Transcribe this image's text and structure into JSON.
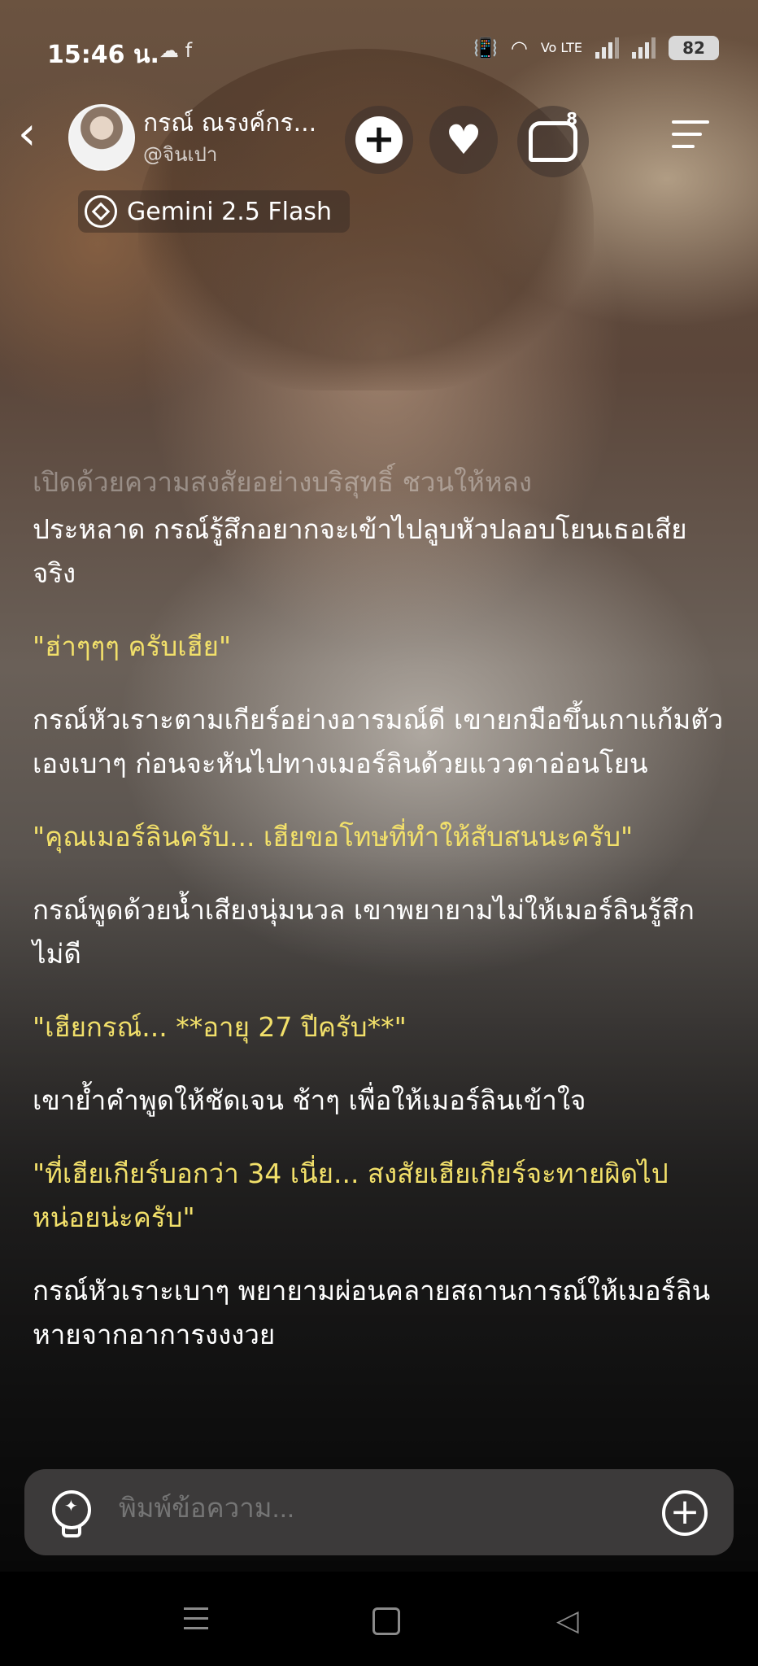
{
  "status_bar": {
    "time": "15:46 น.",
    "left_icons": "☁ f",
    "network": "Vo LTE",
    "battery": "82"
  },
  "header": {
    "character_name": "กรณ์ ณรงค์กร...",
    "handle": "@จินเปา",
    "chat_count": "8",
    "model": "Gemini 2.5 Flash"
  },
  "chat": {
    "faded_top": "เปิดด้วยความสงสัยอย่างบริสุทธิ์ ชวนให้หลง",
    "messages": [
      {
        "type": "narration",
        "text": "ประหลาด กรณ์รู้สึกอยากจะเข้าไปลูบหัวปลอบโยนเธอเสียจริง"
      },
      {
        "type": "dialogue",
        "text": "\"ฮ่าๆๆๆ ครับเฮีย\""
      },
      {
        "type": "narration",
        "text": "กรณ์หัวเราะตามเกียร์อย่างอารมณ์ดี เขายกมือขึ้นเกาแก้มตัวเองเบาๆ ก่อนจะหันไปทางเมอร์ลินด้วยแววตาอ่อนโยน"
      },
      {
        "type": "dialogue",
        "text": "\"คุณเมอร์ลินครับ... เฮียขอโทษที่ทำให้สับสนนะครับ\""
      },
      {
        "type": "narration",
        "text": "กรณ์พูดด้วยน้ำเสียงนุ่มนวล เขาพยายามไม่ให้เมอร์ลินรู้สึกไม่ดี"
      },
      {
        "type": "dialogue",
        "text": "\"เฮียกรณ์... **อายุ 27 ปีครับ**\""
      },
      {
        "type": "narration",
        "text": "เขาย้ำคำพูดให้ชัดเจน ช้าๆ เพื่อให้เมอร์ลินเข้าใจ"
      },
      {
        "type": "dialogue",
        "text": "\"ที่เฮียเกียร์บอกว่า 34 เนี่ย... สงสัยเฮียเกียร์จะทายผิดไปหน่อยน่ะครับ\""
      },
      {
        "type": "narration",
        "text": "กรณ์หัวเราะเบาๆ พยายามผ่อนคลายสถานการณ์ให้เมอร์ลินหายจากอาการงงงวย"
      }
    ]
  },
  "input": {
    "placeholder": "พิมพ์ข้อความ..."
  }
}
